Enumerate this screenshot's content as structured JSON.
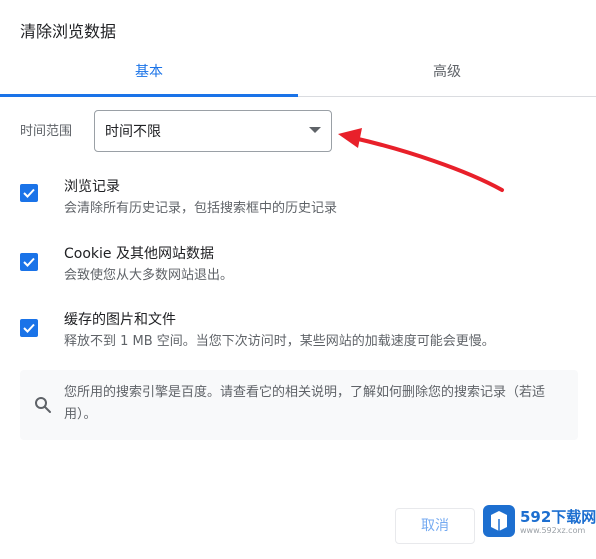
{
  "dialog": {
    "title": "清除浏览数据"
  },
  "tabs": {
    "basic": "基本",
    "advanced": "高级"
  },
  "time_range": {
    "label": "时间范围",
    "selected": "时间不限"
  },
  "options": [
    {
      "title": "浏览记录",
      "description": "会清除所有历史记录，包括搜索框中的历史记录",
      "checked": true
    },
    {
      "title": "Cookie 及其他网站数据",
      "description": "会致使您从大多数网站退出。",
      "checked": true
    },
    {
      "title": "缓存的图片和文件",
      "description": "释放不到 1 MB 空间。当您下次访问时，某些网站的加载速度可能会更慢。",
      "checked": true
    }
  ],
  "info": {
    "text": "您所用的搜索引擎是百度。请查看它的相关说明，了解如何删除您的搜索记录（若适用）。",
    "icon": "search-icon"
  },
  "footer": {
    "cancel_label": "取消"
  },
  "watermark": {
    "text": "592下载网",
    "sub": "www.592xz.com"
  },
  "colors": {
    "accent": "#1a73e8",
    "annotation_arrow": "#e8202a"
  }
}
